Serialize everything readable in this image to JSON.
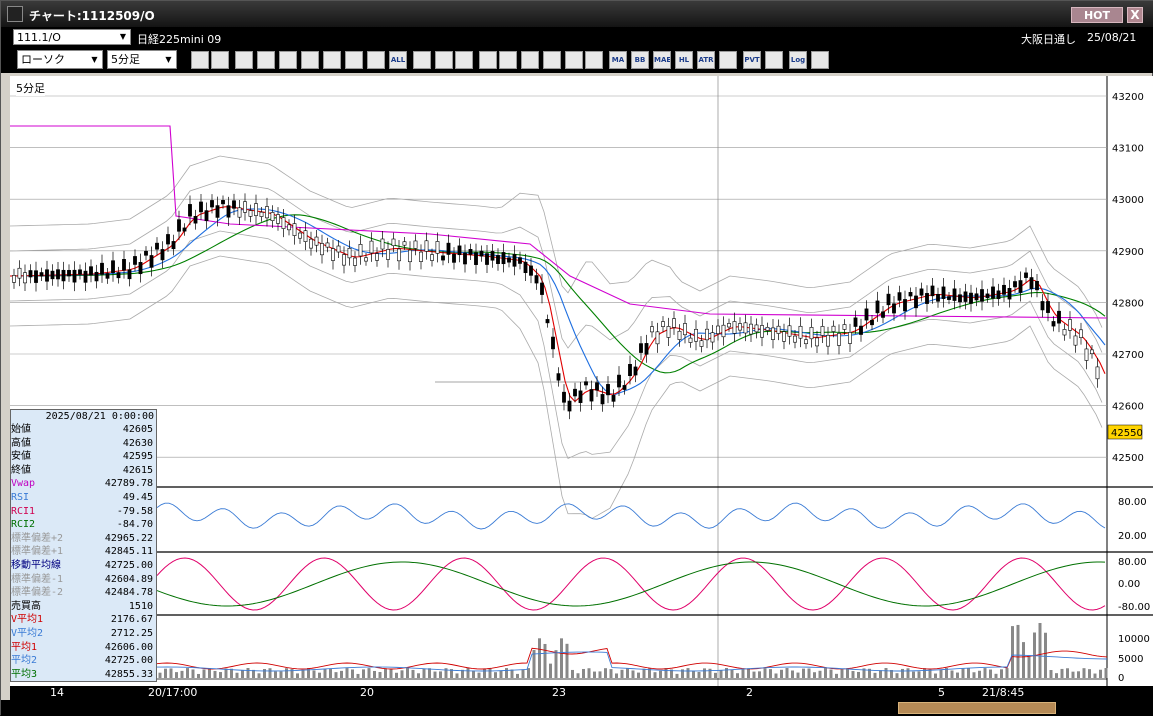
{
  "window": {
    "title": "チャート:1112509/O",
    "hot_label": "HOT",
    "close_label": "X"
  },
  "header": {
    "symbol": "111.1/O",
    "instrument": "日経225mini 09",
    "session": "大阪日通し",
    "date": "25/08/21"
  },
  "toolbar": {
    "chart_type": "ローソク",
    "interval": "5分足",
    "icons": [
      {
        "name": "zoom-icon",
        "t": ""
      },
      {
        "name": "window-icon",
        "t": ""
      },
      {
        "name": "pen-icon",
        "t": ""
      },
      {
        "name": "cursor-icon",
        "t": ""
      },
      {
        "name": "undo-icon",
        "t": ""
      },
      {
        "name": "notes-icon",
        "t": ""
      },
      {
        "name": "trash-icon",
        "t": ""
      },
      {
        "name": "candle-icon",
        "t": ""
      },
      {
        "name": "candle-delete-icon",
        "t": ""
      },
      {
        "name": "all-icon",
        "t": "ALL"
      },
      {
        "name": "settings-icon",
        "t": ""
      },
      {
        "name": "tools-icon",
        "t": ""
      },
      {
        "name": "color-icon",
        "t": ""
      },
      {
        "name": "alert-icon",
        "t": ""
      },
      {
        "name": "search-icon",
        "t": ""
      },
      {
        "name": "compare-icon",
        "t": ""
      },
      {
        "name": "crosshair-icon",
        "t": ""
      },
      {
        "name": "info-icon",
        "t": ""
      },
      {
        "name": "grid-icon",
        "t": ""
      },
      {
        "name": "ma-icon",
        "t": "MA"
      },
      {
        "name": "bb-icon",
        "t": "BB"
      },
      {
        "name": "mae-icon",
        "t": "MAE"
      },
      {
        "name": "hl-icon",
        "t": "HL"
      },
      {
        "name": "atr-icon",
        "t": "ATR"
      },
      {
        "name": "pb-icon",
        "t": ""
      },
      {
        "name": "pvt-icon",
        "t": "PVT"
      },
      {
        "name": "frame-icon",
        "t": ""
      },
      {
        "name": "log-icon",
        "t": "Log"
      },
      {
        "name": "export-icon",
        "t": ""
      }
    ]
  },
  "chart": {
    "timeframe_label": "5分足",
    "price_axis": [
      "43200",
      "43100",
      "43000",
      "42900",
      "42800",
      "42700",
      "42600",
      "42500"
    ],
    "current_price": "42550",
    "indicator_axis": [
      "80.00",
      "20.00"
    ],
    "rci_axis": [
      "80.00",
      "0.00",
      "-80.00"
    ],
    "volume_axis": [
      "10000",
      "5000",
      "0"
    ],
    "x_labels": [
      "14",
      "20/17:00",
      "20",
      "23",
      "2",
      "5",
      "21/8:45"
    ]
  },
  "datapanel": {
    "timestamp": "2025/08/21 0:00:00",
    "rows": [
      {
        "label": "始値",
        "value": "42605",
        "color": "#000"
      },
      {
        "label": "高値",
        "value": "42630",
        "color": "#000"
      },
      {
        "label": "安値",
        "value": "42595",
        "color": "#000"
      },
      {
        "label": "終値",
        "value": "42615",
        "color": "#000"
      },
      {
        "label": "Vwap",
        "value": "42789.78",
        "color": "#c000c0"
      },
      {
        "label": "RSI",
        "value": "49.45",
        "color": "#3a7bd5"
      },
      {
        "label": "RCI1",
        "value": "-79.58",
        "color": "#d00050"
      },
      {
        "label": "RCI2",
        "value": "-84.70",
        "color": "#007000"
      },
      {
        "label": "標準偏差+2",
        "value": "42965.22",
        "color": "#999"
      },
      {
        "label": "標準偏差+1",
        "value": "42845.11",
        "color": "#999"
      },
      {
        "label": "移動平均線",
        "value": "42725.00",
        "color": "#000080"
      },
      {
        "label": "標準偏差-1",
        "value": "42604.89",
        "color": "#999"
      },
      {
        "label": "標準偏差-2",
        "value": "42484.78",
        "color": "#999"
      },
      {
        "label": "売買高",
        "value": "1510",
        "color": "#000"
      },
      {
        "label": "V平均1",
        "value": "2176.67",
        "color": "#d00000"
      },
      {
        "label": "V平均2",
        "value": "2712.25",
        "color": "#3a7bd5"
      },
      {
        "label": "平均1",
        "value": "42606.00",
        "color": "#d00000"
      },
      {
        "label": "平均2",
        "value": "42725.00",
        "color": "#3a7bd5"
      },
      {
        "label": "平均3",
        "value": "42855.33",
        "color": "#007000"
      }
    ]
  }
}
